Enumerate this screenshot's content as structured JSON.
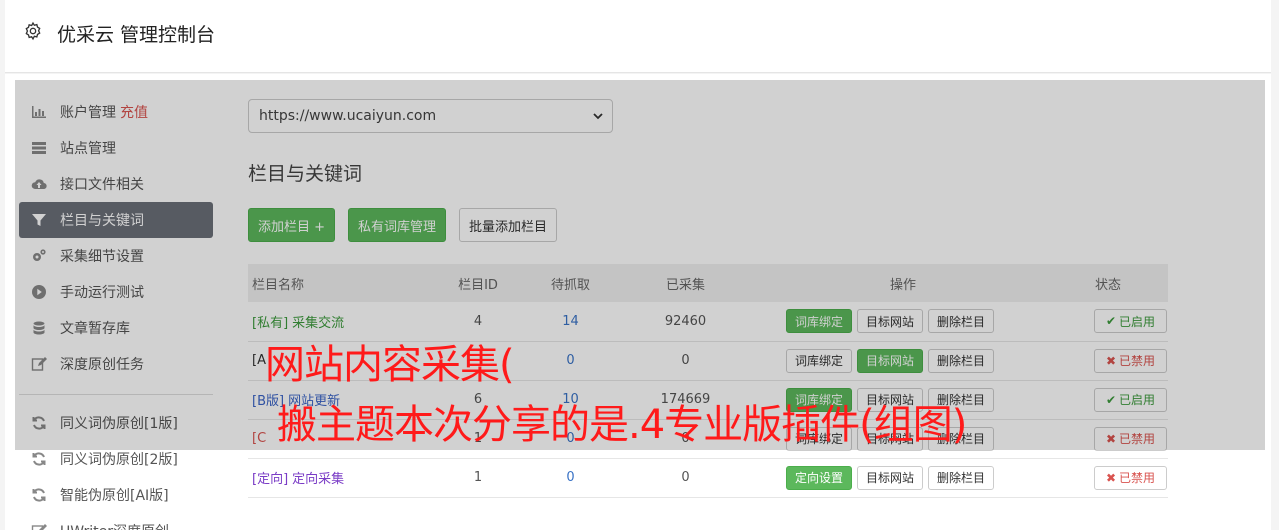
{
  "header": {
    "title": "优采云 管理控制台",
    "icon": "gear-icon"
  },
  "sidebar": {
    "items": [
      {
        "label": "账户管理",
        "badge": "充值",
        "icon": "bar-chart-icon"
      },
      {
        "label": "站点管理",
        "icon": "server-icon"
      },
      {
        "label": "接口文件相关",
        "icon": "cloud-upload-icon"
      },
      {
        "label": "栏目与关键词",
        "icon": "filter-icon",
        "active": true
      },
      {
        "label": "采集细节设置",
        "icon": "cogs-icon"
      },
      {
        "label": "手动运行测试",
        "icon": "play-icon"
      },
      {
        "label": "文章暂存库",
        "icon": "database-icon"
      },
      {
        "label": "深度原创任务",
        "icon": "edit-icon"
      }
    ],
    "items2": [
      {
        "label": "同义词伪原创[1版]",
        "icon": "refresh-icon"
      },
      {
        "label": "同义词伪原创[2版]",
        "icon": "refresh-icon"
      },
      {
        "label": "智能伪原创[AI版]",
        "icon": "refresh-icon"
      },
      {
        "label": "UWriter深度原创",
        "icon": "edit-icon"
      }
    ]
  },
  "main": {
    "site_select": "https://www.ucaiyun.com",
    "section_title": "栏目与关键词",
    "buttons": {
      "add": "添加栏目 +",
      "private_lib": "私有词库管理",
      "batch_add": "批量添加栏目"
    },
    "table": {
      "headers": [
        "栏目名称",
        "栏目ID",
        "待抓取",
        "已采集",
        "操作",
        "状态"
      ],
      "rows": [
        {
          "tag": "[私有]",
          "name": "采集交流",
          "id": "4",
          "pending": "14",
          "collected": "92460",
          "op1": "词库绑定",
          "op2": "目标网站",
          "op3": "删除栏目",
          "status": "已启用",
          "status_mark": "✔"
        },
        {
          "tag": "[A",
          "name": "",
          "id": "",
          "pending": "0",
          "collected": "0",
          "op1": "词库绑定",
          "op2": "目标网站",
          "op3": "删除栏目",
          "status": "已禁用",
          "status_mark": "✖"
        },
        {
          "tag": "[B版]",
          "name": "网站更新",
          "id": "6",
          "pending": "10",
          "collected": "174669",
          "op1": "词库绑定",
          "op2": "目标网站",
          "op3": "删除栏目",
          "status": "已启用",
          "status_mark": "✔"
        },
        {
          "tag": "[C",
          "name": "",
          "id": "1",
          "pending": "0",
          "collected": "0",
          "op1": "词库绑定",
          "op2": "目标网站",
          "op3": "删除栏目",
          "status": "已禁用",
          "status_mark": "✖"
        },
        {
          "tag": "[定向]",
          "name": "定向采集",
          "id": "1",
          "pending": "0",
          "collected": "0",
          "op1": "定向设置",
          "op2": "目标网站",
          "op3": "删除栏目",
          "status": "已禁用",
          "status_mark": "✖"
        }
      ]
    }
  },
  "watermark": {
    "line1": "网站内容采集(",
    "line2": "搬主题本次分享的是.4专业版插件(组图)"
  },
  "colors": {
    "green": "#5cb85c",
    "red": "#d9534f",
    "active_nav": "#6b6f78",
    "watermark": "#ff1a1a"
  }
}
